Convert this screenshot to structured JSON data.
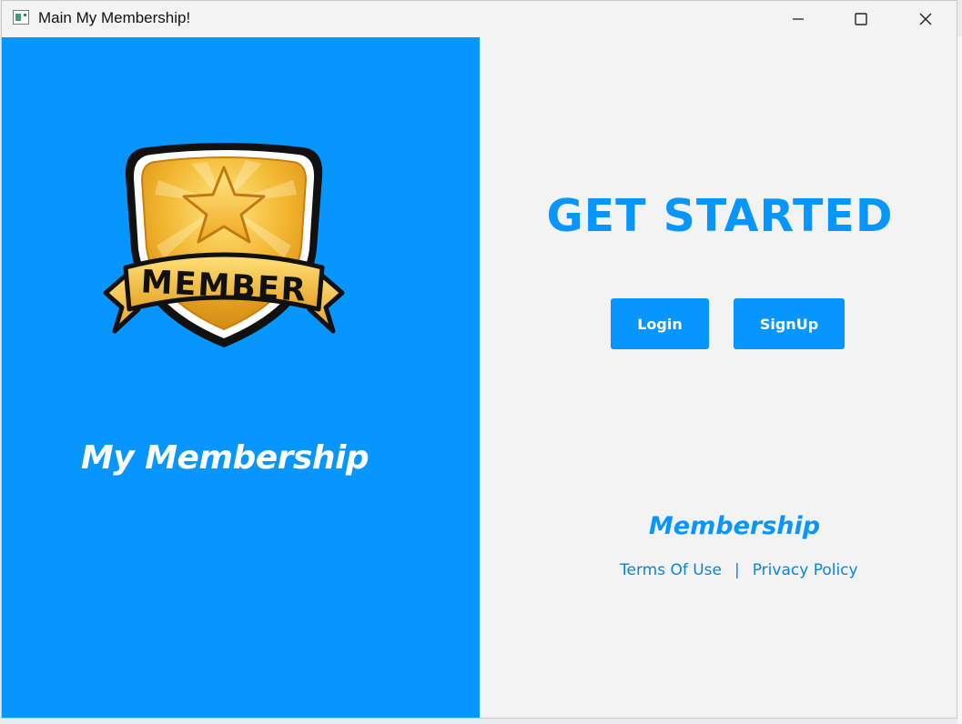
{
  "window": {
    "title": "Main My Membership!"
  },
  "controls": {
    "minimize_icon": "minimize-icon",
    "maximize_icon": "maximize-icon",
    "close_icon": "close-icon"
  },
  "left_panel": {
    "badge_text": "MEMBER",
    "brand_title": "My Membership",
    "background": "#0796fe"
  },
  "right_panel": {
    "headline": "GET STARTED",
    "login_label": "Login",
    "signup_label": "SignUp",
    "footer_brand": "Membership",
    "terms_link": "Terms Of Use",
    "separator": "|",
    "privacy_link": "Privacy Policy"
  },
  "colors": {
    "accent": "#0796fe",
    "panel_bg": "#f3f3f4",
    "link": "#0b84da"
  }
}
